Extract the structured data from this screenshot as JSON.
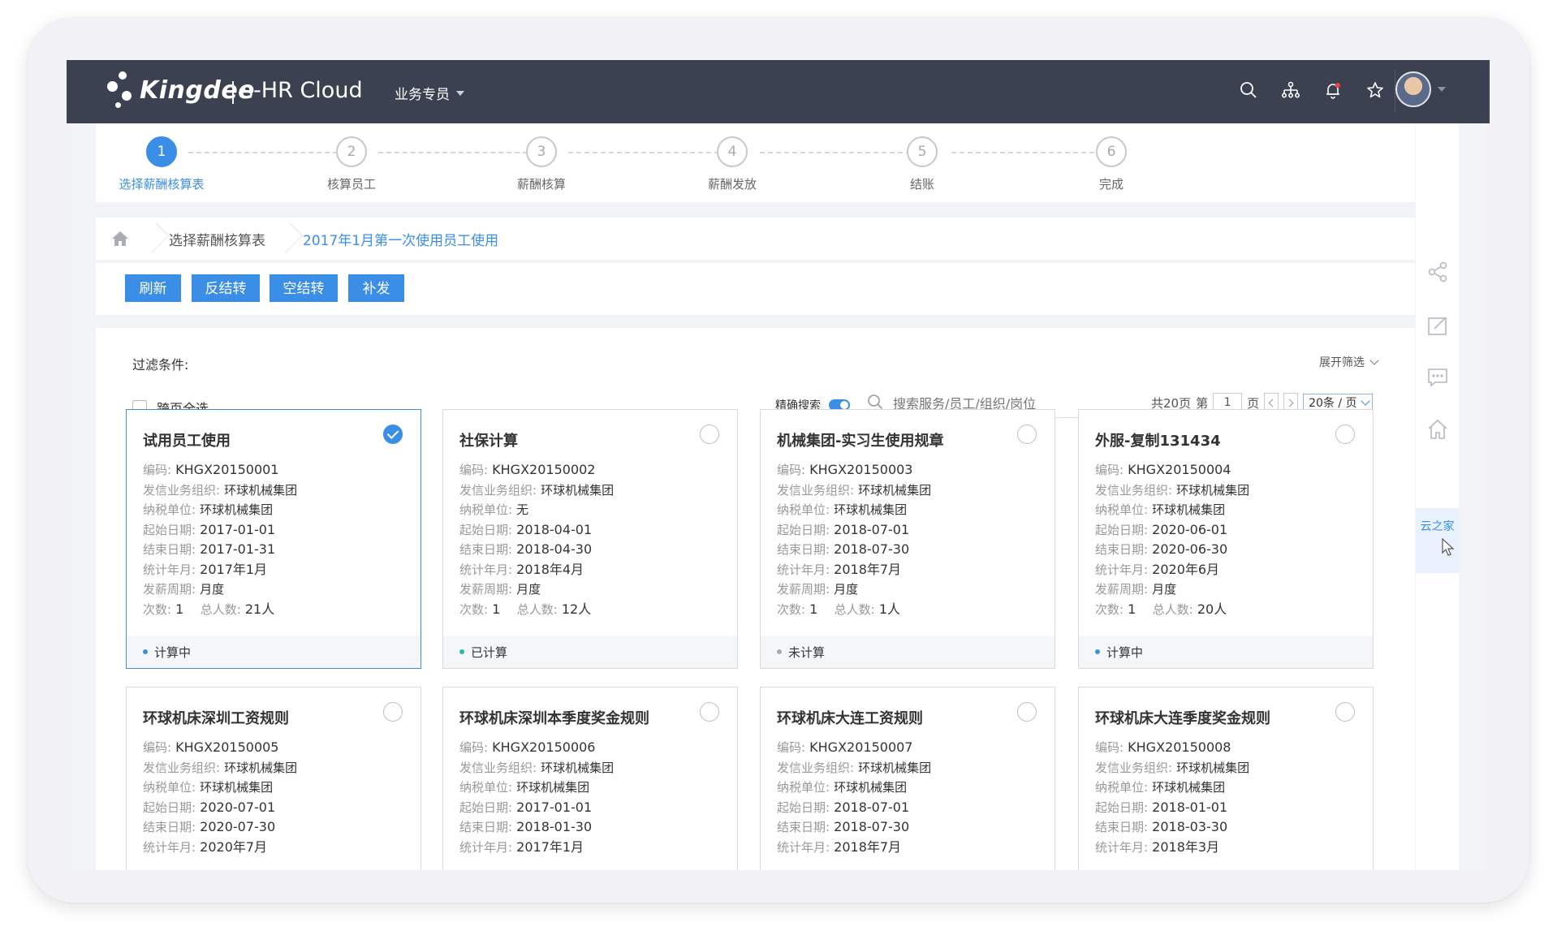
{
  "header": {
    "brand": "Kingdee",
    "product": "s-HR Cloud",
    "role": "业务专员",
    "icons": [
      "search-icon",
      "org-chart-icon",
      "bell-icon",
      "star-icon",
      "apps-grid-icon"
    ],
    "accent": "#3a8ee6",
    "bar_color": "#3b4150"
  },
  "steps": [
    {
      "num": "1",
      "label": "选择薪酬核算表",
      "active": true
    },
    {
      "num": "2",
      "label": "核算员工",
      "active": false
    },
    {
      "num": "3",
      "label": "薪酬核算",
      "active": false
    },
    {
      "num": "4",
      "label": "薪酬发放",
      "active": false
    },
    {
      "num": "5",
      "label": "结账",
      "active": false
    },
    {
      "num": "6",
      "label": "完成",
      "active": false
    }
  ],
  "breadcrumb": {
    "items": [
      "选择薪酬核算表",
      "2017年1月第一次使用员工使用"
    ]
  },
  "toolbar": {
    "refresh": "刷新",
    "reverse": "反结转",
    "empty": "空结转",
    "reissue": "补发"
  },
  "filter": {
    "label": "过滤条件:",
    "expand": "展开筛选",
    "select_all": "跨页全选",
    "precise": "精确搜索",
    "search_placeholder": "搜索服务/员工/组织/岗位"
  },
  "pager": {
    "total": "共20页",
    "page_prefix": "第",
    "page": "1",
    "page_suffix": "页",
    "size": "20条 / 页"
  },
  "field_labels": {
    "code": "编码:",
    "org": "发信业务组织:",
    "tax": "纳税单位:",
    "start": "起始日期:",
    "end": "结束日期:",
    "period": "统计年月:",
    "cycle": "发薪周期:",
    "times": "次数:",
    "people": "总人数:"
  },
  "cards": [
    {
      "title": "试用员工使用",
      "selected": true,
      "code": "KHGX20150001",
      "org": "环球机械集团",
      "tax": "环球机械集团",
      "start": "2017-01-01",
      "end": "2017-01-31",
      "period": "2017年1月",
      "cycle": "月度",
      "times": "1",
      "people": "21人",
      "status": "计算中",
      "status_color": "#3a8ee6"
    },
    {
      "title": "社保计算",
      "selected": false,
      "code": "KHGX20150002",
      "org": "环球机械集团",
      "tax": "无",
      "start": "2018-04-01",
      "end": "2018-04-30",
      "period": "2018年4月",
      "cycle": "月度",
      "times": "1",
      "people": "12人",
      "status": "已计算",
      "status_color": "#29b9a8"
    },
    {
      "title": "机械集团-实习生使用规章",
      "selected": false,
      "code": "KHGX20150003",
      "org": "环球机械集团",
      "tax": "环球机械集团",
      "start": "2018-07-01",
      "end": "2018-07-30",
      "period": "2018年7月",
      "cycle": "月度",
      "times": "1",
      "people": "1人",
      "status": "未计算",
      "status_color": "#aaaaaa"
    },
    {
      "title": "外服-复制131434",
      "selected": false,
      "code": "KHGX20150004",
      "org": "环球机械集团",
      "tax": "环球机械集团",
      "start": "2020-06-01",
      "end": "2020-06-30",
      "period": "2020年6月",
      "cycle": "月度",
      "times": "1",
      "people": "20人",
      "status": "计算中",
      "status_color": "#3a8ee6"
    },
    {
      "title": "环球机床深圳工资规则",
      "selected": false,
      "code": "KHGX20150005",
      "org": "环球机械集团",
      "tax": "环球机械集团",
      "start": "2020-07-01",
      "end": "2020-07-30",
      "period": "2020年7月"
    },
    {
      "title": "环球机床深圳本季度奖金规则",
      "selected": false,
      "code": "KHGX20150006",
      "org": "环球机械集团",
      "tax": "环球机械集团",
      "start": "2017-01-01",
      "end": "2018-01-30",
      "period": "2017年1月"
    },
    {
      "title": "环球机床大连工资规则",
      "selected": false,
      "code": "KHGX20150007",
      "org": "环球机械集团",
      "tax": "环球机械集团",
      "start": "2018-07-01",
      "end": "2018-07-30",
      "period": "2018年7月"
    },
    {
      "title": "环球机床大连季度奖金规则",
      "selected": false,
      "code": "KHGX20150008",
      "org": "环球机械集团",
      "tax": "环球机械集团",
      "start": "2018-01-01",
      "end": "2018-03-30",
      "period": "2018年3月"
    }
  ],
  "rail": {
    "icons": [
      "share-icon",
      "edit-icon",
      "chat-icon",
      "home-icon"
    ],
    "yun": "云之家"
  }
}
